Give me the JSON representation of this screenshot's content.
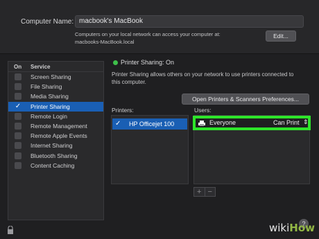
{
  "computer_name": {
    "label": "Computer Name:",
    "value": "macbook's MacBook",
    "description_line1": "Computers on your local network can access your computer at:",
    "description_line2": "macbooks-MacBook.local",
    "edit_label": "Edit..."
  },
  "services": {
    "header_on": "On",
    "header_service": "Service",
    "items": [
      {
        "label": "Screen Sharing",
        "checked": false
      },
      {
        "label": "File Sharing",
        "checked": false
      },
      {
        "label": "Media Sharing",
        "checked": false
      },
      {
        "label": "Printer Sharing",
        "checked": true,
        "selected": true
      },
      {
        "label": "Remote Login",
        "checked": false
      },
      {
        "label": "Remote Management",
        "checked": false
      },
      {
        "label": "Remote Apple Events",
        "checked": false
      },
      {
        "label": "Internet Sharing",
        "checked": false
      },
      {
        "label": "Bluetooth Sharing",
        "checked": false
      },
      {
        "label": "Content Caching",
        "checked": false
      }
    ]
  },
  "printer_sharing": {
    "status": "Printer Sharing: On",
    "status_color": "#3ec04a",
    "description_line1": "Printer Sharing allows others on your network to use printers connected to",
    "description_line2": "this computer.",
    "open_prefs_label": "Open Printers & Scanners Preferences...",
    "printers_label": "Printers:",
    "users_label": "Users:",
    "printers": [
      {
        "name": "HP Officejet 100",
        "checked": true
      }
    ],
    "users": [
      {
        "name": "Everyone",
        "permission": "Can Print"
      }
    ],
    "add_label": "+",
    "remove_label": "−"
  },
  "colors": {
    "selection": "#1a5fb4",
    "highlight_outline": "#2ee52a"
  },
  "watermark": {
    "wiki": "wiki",
    "how": "How"
  },
  "help_label": "?"
}
